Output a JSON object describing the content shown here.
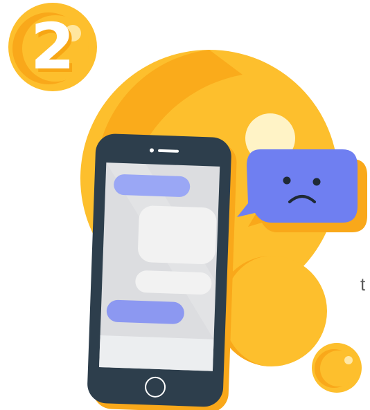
{
  "badge": {
    "digit": "2"
  },
  "edge_text": "t",
  "illustration": {
    "subject": "smartphone-with-sad-chat-bubble",
    "icons": [
      "number-badge-icon",
      "smartphone-icon",
      "sad-face-icon",
      "chat-bubble-icon"
    ]
  },
  "colors": {
    "yellow": "#fdbf2d",
    "yellow_dark": "#f9a81a",
    "phone_body": "#2d3e4c",
    "screen": "#dcdde0",
    "bubble_blue": "#6f7ff1",
    "message_light": "#f2f2f2",
    "highlight": "#fff3c6"
  }
}
